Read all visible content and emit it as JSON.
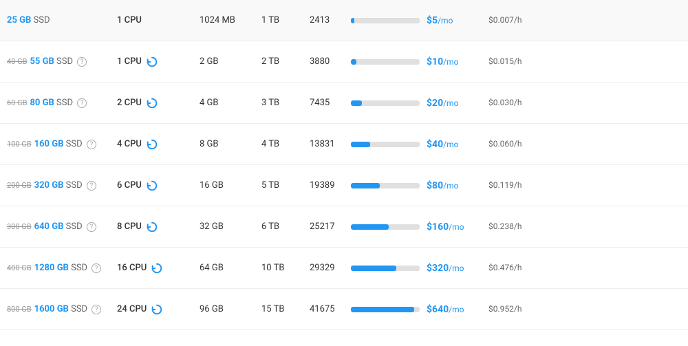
{
  "rows": [
    {
      "storage_old": "",
      "storage_new": "25 GB",
      "storage_type": "SSD",
      "has_old": false,
      "cpu": "1 CPU",
      "has_speed_icon": false,
      "ram": "1024 MB",
      "transfer": "1 TB",
      "speed": "2413",
      "bar_pct": 5,
      "price_mo": "$5",
      "price_hourly": "$0.007/h"
    },
    {
      "storage_old": "40 GB",
      "storage_new": "55 GB",
      "storage_type": "SSD",
      "has_old": true,
      "cpu": "1 CPU",
      "has_speed_icon": true,
      "ram": "2 GB",
      "transfer": "2 TB",
      "speed": "3880",
      "bar_pct": 8,
      "price_mo": "$10",
      "price_hourly": "$0.015/h"
    },
    {
      "storage_old": "60 GB",
      "storage_new": "80 GB",
      "storage_type": "SSD",
      "has_old": true,
      "cpu": "2 CPU",
      "has_speed_icon": true,
      "ram": "4 GB",
      "transfer": "3 TB",
      "speed": "7435",
      "bar_pct": 16,
      "price_mo": "$20",
      "price_hourly": "$0.030/h"
    },
    {
      "storage_old": "100 GB",
      "storage_new": "160 GB",
      "storage_type": "SSD",
      "has_old": true,
      "cpu": "4 CPU",
      "has_speed_icon": true,
      "ram": "8 GB",
      "transfer": "4 TB",
      "speed": "13831",
      "bar_pct": 28,
      "price_mo": "$40",
      "price_hourly": "$0.060/h"
    },
    {
      "storage_old": "200 GB",
      "storage_new": "320 GB",
      "storage_type": "SSD",
      "has_old": true,
      "cpu": "6 CPU",
      "has_speed_icon": true,
      "ram": "16 GB",
      "transfer": "5 TB",
      "speed": "19389",
      "bar_pct": 42,
      "price_mo": "$80",
      "price_hourly": "$0.119/h"
    },
    {
      "storage_old": "300 GB",
      "storage_new": "640 GB",
      "storage_type": "SSD",
      "has_old": true,
      "cpu": "8 CPU",
      "has_speed_icon": true,
      "ram": "32 GB",
      "transfer": "6 TB",
      "speed": "25217",
      "bar_pct": 55,
      "price_mo": "$160",
      "price_hourly": "$0.238/h"
    },
    {
      "storage_old": "400 GB",
      "storage_new": "1280 GB",
      "storage_type": "SSD",
      "has_old": true,
      "cpu": "16 CPU",
      "has_speed_icon": true,
      "ram": "64 GB",
      "transfer": "10 TB",
      "speed": "29329",
      "bar_pct": 66,
      "price_mo": "$320",
      "price_hourly": "$0.476/h"
    },
    {
      "storage_old": "800 GB",
      "storage_new": "1600 GB",
      "storage_type": "SSD",
      "has_old": true,
      "cpu": "24 CPU",
      "has_speed_icon": true,
      "ram": "96 GB",
      "transfer": "15 TB",
      "speed": "41675",
      "bar_pct": 92,
      "price_mo": "$640",
      "price_hourly": "$0.952/h"
    }
  ],
  "labels": {
    "help": "?"
  }
}
